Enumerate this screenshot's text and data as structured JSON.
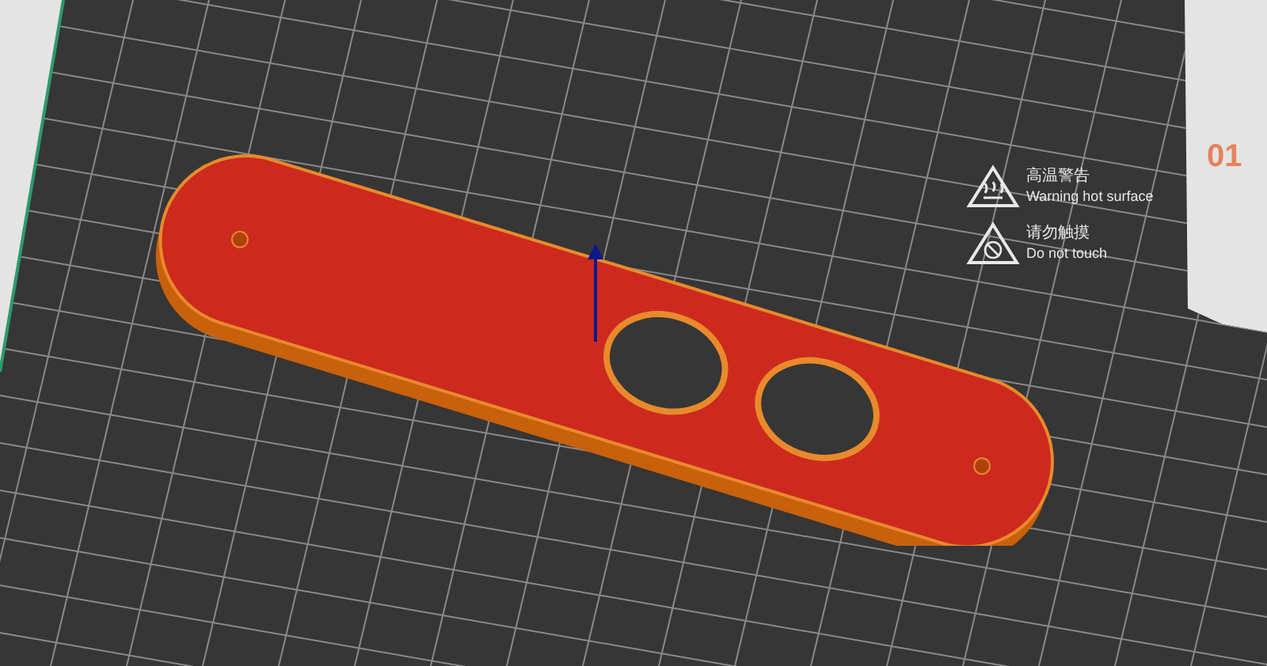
{
  "bed": {
    "corner_label": "01",
    "warnings": [
      {
        "kind": "hot",
        "title": "高温警告",
        "text": "Warning hot surface"
      },
      {
        "kind": "touch",
        "title": "请勿触摸",
        "text": "Do not touch"
      }
    ]
  }
}
